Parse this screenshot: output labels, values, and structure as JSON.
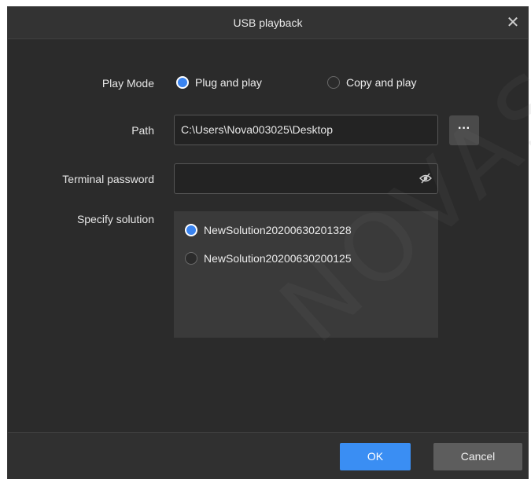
{
  "dialog": {
    "title": "USB playback",
    "close_icon": "close-icon"
  },
  "play_mode": {
    "label": "Play Mode",
    "options": [
      {
        "label": "Plug and play",
        "selected": true
      },
      {
        "label": "Copy and play",
        "selected": false
      }
    ]
  },
  "path": {
    "label": "Path",
    "value": "C:\\Users\\Nova003025\\Desktop",
    "browse_label": "···"
  },
  "terminal_password": {
    "label": "Terminal password",
    "value": "",
    "toggle_icon": "eye-off-icon"
  },
  "solution": {
    "label": "Specify solution",
    "items": [
      {
        "label": "NewSolution20200630201328",
        "selected": true
      },
      {
        "label": "NewSolution20200630200125",
        "selected": false
      }
    ]
  },
  "footer": {
    "ok_label": "OK",
    "cancel_label": "Cancel"
  },
  "watermark": "NOVASTAR T",
  "colors": {
    "accent": "#3a8ef3",
    "background": "#2b2b2b",
    "list_background": "#3a3a3a"
  }
}
